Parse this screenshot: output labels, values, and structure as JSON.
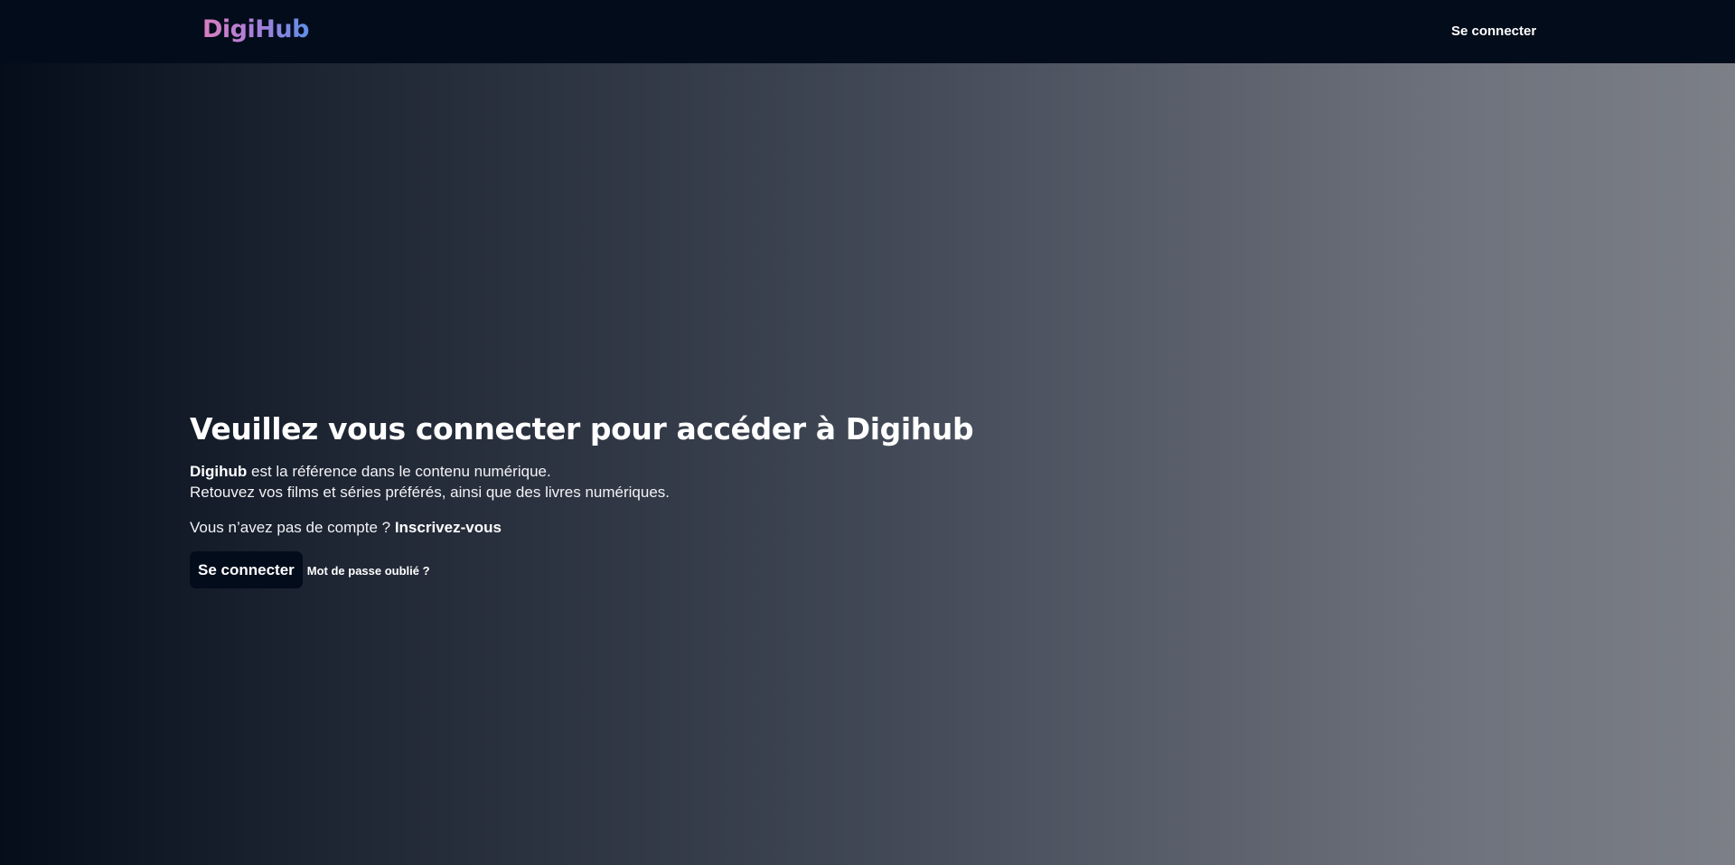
{
  "header": {
    "logo_text": "DigiHub",
    "login_link": "Se connecter"
  },
  "hero": {
    "title": "Veuillez vous connecter pour accéder à Digihub",
    "brand_name": "Digihub",
    "desc_line1_rest": " est la référence dans le contenu numérique.",
    "desc_line2": "Retouvez vos films et séries préférés, ainsi que des livres numériques.",
    "no_account_text": "Vous n’avez pas de compte ? ",
    "signup_link": "Inscrivez-vous",
    "login_button": "Se connecter",
    "forgot_password_link": "Mot de passe oublié ?"
  },
  "colors": {
    "navbar_bg": "#030c1b",
    "button_bg": "#030c1b",
    "logo_gradient": [
      "#d87ec0",
      "#b07ed8",
      "#5f8fe8"
    ]
  }
}
